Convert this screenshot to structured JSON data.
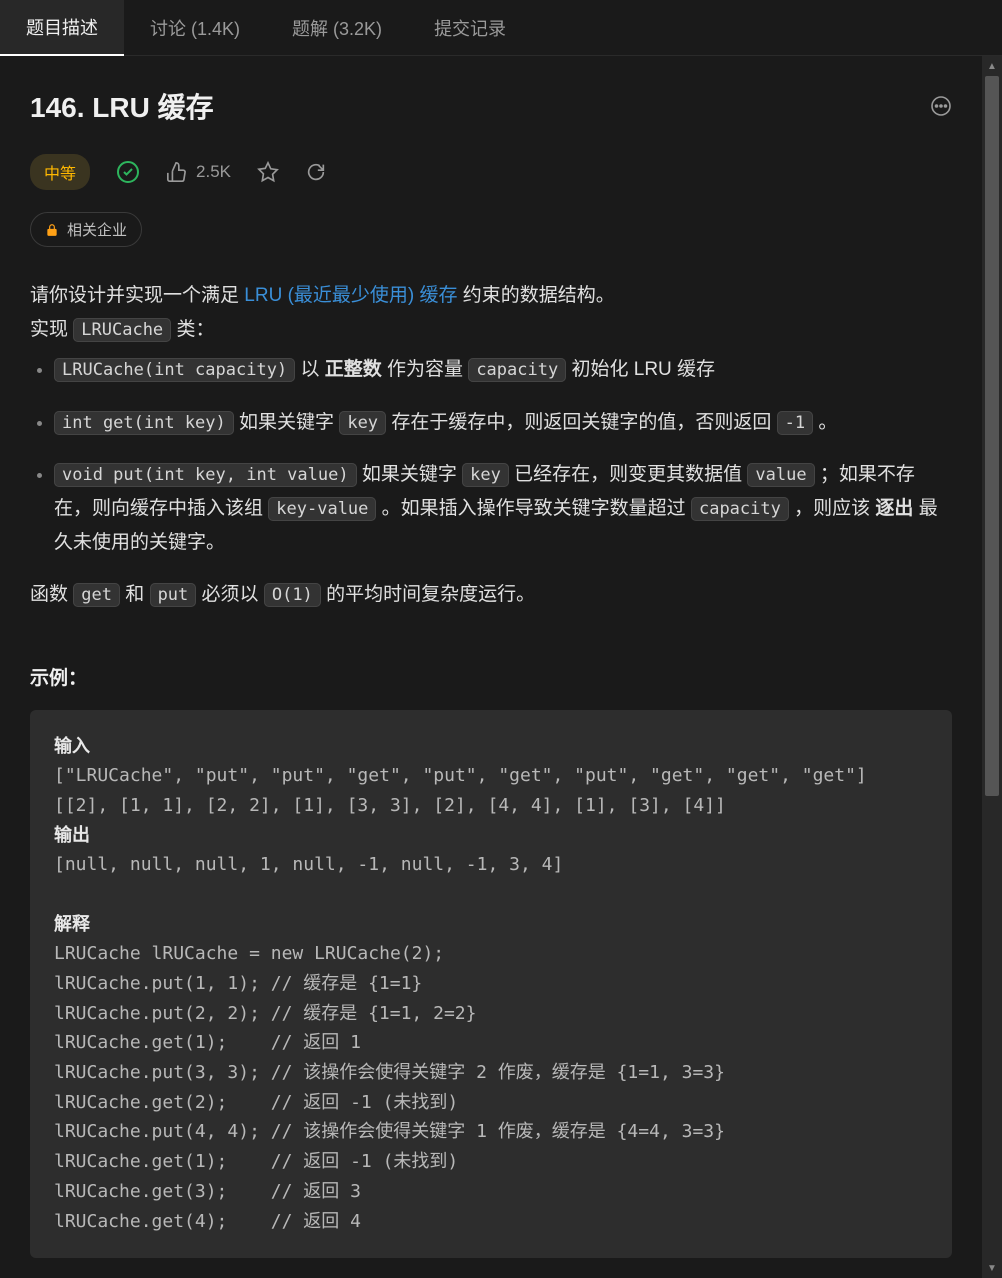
{
  "tabs": [
    {
      "label": "题目描述",
      "active": true
    },
    {
      "label": "讨论 (1.4K)",
      "active": false
    },
    {
      "label": "题解 (3.2K)",
      "active": false
    },
    {
      "label": "提交记录",
      "active": false
    }
  ],
  "title": "146. LRU 缓存",
  "difficulty": "中等",
  "likes": "2.5K",
  "companies_tag": "相关企业",
  "desc": {
    "intro_1": "请你设计并实现一个满足  ",
    "link_text": "LRU (最近最少使用) 缓存",
    "intro_2": " 约束的数据结构。",
    "implement": "实现 ",
    "class_name": "LRUCache",
    "implement_2": " 类：",
    "b1_code": "LRUCache(int capacity)",
    "b1_t1": " 以 ",
    "b1_bold": "正整数",
    "b1_t2": " 作为容量 ",
    "b1_code2": "capacity",
    "b1_t3": " 初始化 LRU 缓存",
    "b2_code": "int get(int key)",
    "b2_t1": " 如果关键字 ",
    "b2_code2": "key",
    "b2_t2": " 存在于缓存中，则返回关键字的值，否则返回 ",
    "b2_code3": "-1",
    "b2_t3": " 。",
    "b3_code": "void put(int key, int value)",
    "b3_t1": " 如果关键字 ",
    "b3_code2": "key",
    "b3_t2": " 已经存在，则变更其数据值 ",
    "b3_code3": "value",
    "b3_t3": " ；如果不存在，则向缓存中插入该组 ",
    "b3_code4": "key-value",
    "b3_t4": " 。如果插入操作导致关键字数量超过 ",
    "b3_code5": "capacity",
    "b3_t5": " ，则应该 ",
    "b3_bold": "逐出",
    "b3_t6": " 最久未使用的关键字。",
    "footer_1": "函数 ",
    "footer_code1": "get",
    "footer_2": " 和 ",
    "footer_code2": "put",
    "footer_3": " 必须以 ",
    "footer_code3": "O(1)",
    "footer_4": " 的平均时间复杂度运行。"
  },
  "example_label": "示例：",
  "example": {
    "input_hdr": "输入",
    "input_line1": "[\"LRUCache\", \"put\", \"put\", \"get\", \"put\", \"get\", \"put\", \"get\", \"get\", \"get\"]",
    "input_line2": "[[2], [1, 1], [2, 2], [1], [3, 3], [2], [4, 4], [1], [3], [4]]",
    "output_hdr": "输出",
    "output_line": "[null, null, null, 1, null, -1, null, -1, 3, 4]",
    "explain_hdr": "解释",
    "explain_lines": [
      "LRUCache lRUCache = new LRUCache(2);",
      "lRUCache.put(1, 1); // 缓存是 {1=1}",
      "lRUCache.put(2, 2); // 缓存是 {1=1, 2=2}",
      "lRUCache.get(1);    // 返回 1",
      "lRUCache.put(3, 3); // 该操作会使得关键字 2 作废，缓存是 {1=1, 3=3}",
      "lRUCache.get(2);    // 返回 -1 (未找到)",
      "lRUCache.put(4, 4); // 该操作会使得关键字 1 作废，缓存是 {4=4, 3=3}",
      "lRUCache.get(1);    // 返回 -1 (未找到)",
      "lRUCache.get(3);    // 返回 3",
      "lRUCache.get(4);    // 返回 4"
    ]
  }
}
